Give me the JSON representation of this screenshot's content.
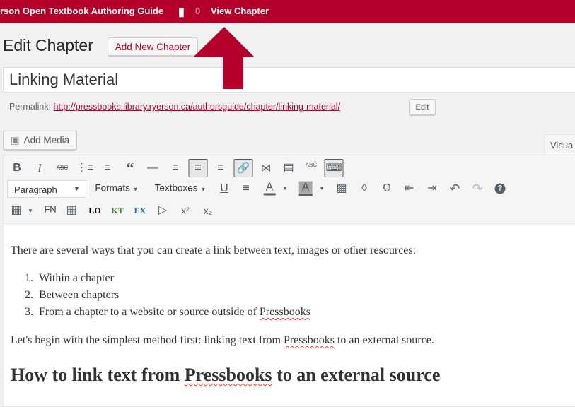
{
  "topbar": {
    "site_title": "rson Open Textbook Authoring Guide",
    "comments_count": "0",
    "view_link": "View Chapter",
    "bg_color": "#b5002b"
  },
  "header": {
    "page_title": "Edit Chapter",
    "add_new_label": "Add New Chapter"
  },
  "title_field": {
    "value": "Linking Material"
  },
  "permalink": {
    "label": "Permalink:",
    "url": "http://pressbooks.library.ryerson.ca/authorsguide/chapter/linking-material/",
    "edit_label": "Edit"
  },
  "media": {
    "add_media_label": "Add Media"
  },
  "editor_tabs": {
    "visual": "Visua"
  },
  "toolbar": {
    "format_select": "Paragraph",
    "formats_label": "Formats",
    "textboxes_label": "Textboxes",
    "fn_label": "FN",
    "lo_label": "LO",
    "kt_label": "KT",
    "ex_label": "EX",
    "strike_label": "ABC",
    "spell_label": "ABC"
  },
  "content": {
    "intro": "There are several ways that you can create a link between text, images or other resources:",
    "list": [
      "Within a chapter",
      "Between chapters",
      "From a chapter to a website or source outside of "
    ],
    "list_last_word": "Pressbooks",
    "para_pre": "Let's begin with the simplest method first: linking text from ",
    "para_word": "Pressbooks",
    "para_post": " to an external source.",
    "heading_pre": "How to link text from ",
    "heading_word": "Pressbooks",
    "heading_post": " to an external source"
  },
  "annotation": {
    "arrow_color": "#b5002b"
  }
}
